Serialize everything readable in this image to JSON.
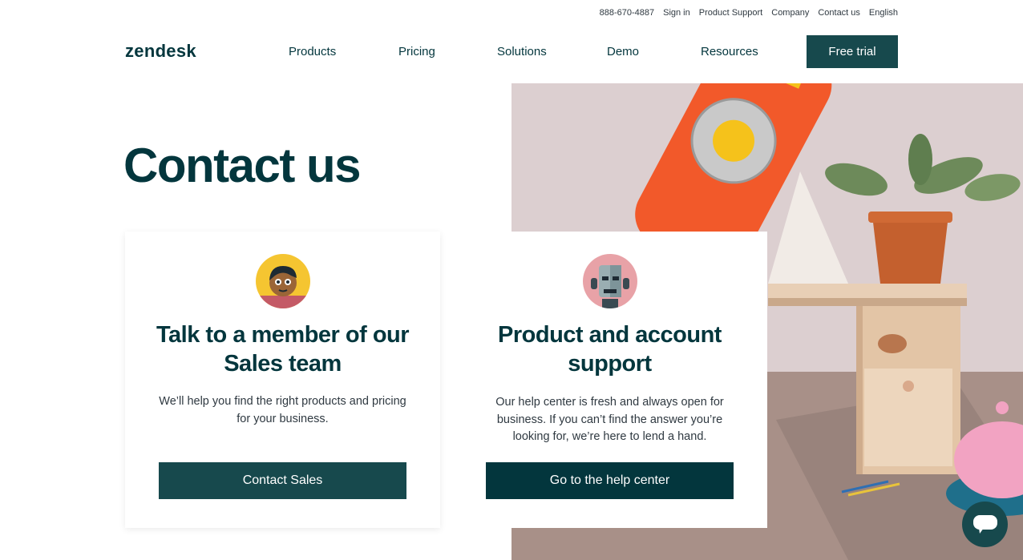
{
  "utility": {
    "phone": "888-670-4887",
    "sign_in": "Sign in",
    "product_support": "Product Support",
    "company": "Company",
    "contact_us": "Contact us",
    "language": "English"
  },
  "header": {
    "logo": "zendesk",
    "nav": [
      "Products",
      "Pricing",
      "Solutions",
      "Demo",
      "Resources"
    ],
    "free_trial": "Free trial"
  },
  "page_title": "Contact us",
  "cards": {
    "sales": {
      "avatar_icon": "sales-agent-avatar-icon",
      "title_line1": "Talk to a member of our",
      "title_line2": "Sales team",
      "desc_line1": "We’ll help you find the right products and pricing",
      "desc_line2": "for your business.",
      "button": "Contact Sales"
    },
    "support": {
      "avatar_icon": "support-robot-avatar-icon",
      "title_line1": "Product and account",
      "title_line2": "support",
      "desc_line1": "Our help center is fresh and always open for",
      "desc_line2": "business. If you can’t find the answer you’re",
      "desc_line3": "looking for, we’re here to lend a hand.",
      "button": "Go to the help center"
    }
  },
  "colors": {
    "brand_dark": "#03363d",
    "brand_button": "#17494d",
    "phone_orange": "#f2592a"
  },
  "chat": {
    "icon": "chat-bubble-icon"
  }
}
